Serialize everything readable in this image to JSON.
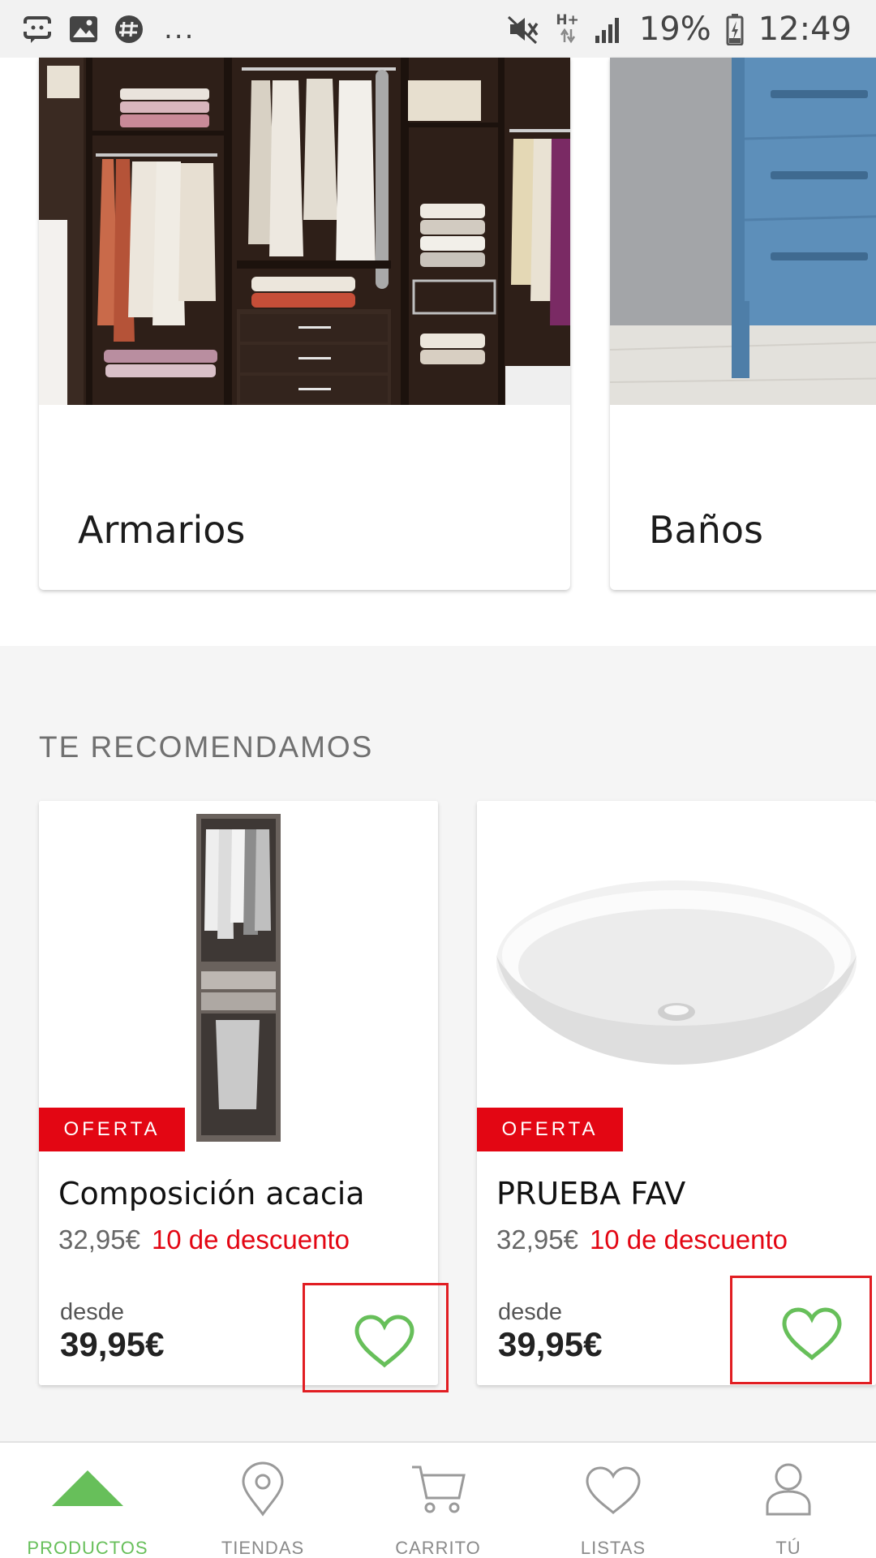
{
  "status_bar": {
    "battery": "19%",
    "time": "12:49",
    "network": "H+",
    "more": "..."
  },
  "categories": [
    {
      "label": "Armarios",
      "image": "wardrobe-photo"
    },
    {
      "label": "Baños",
      "image": "bathroom-cabinet-photo"
    }
  ],
  "recommend": {
    "title": "TE RECOMENDAMOS",
    "products": [
      {
        "badge": "OFERTA",
        "name": "Composición acacia",
        "old_price": "32,95€",
        "discount": "10 de descuento",
        "from_label": "desde",
        "price": "39,95€",
        "image": "wardrobe-module-photo"
      },
      {
        "badge": "OFERTA",
        "name": "PRUEBA FAV",
        "old_price": "32,95€",
        "discount": "10 de descuento",
        "from_label": "desde",
        "price": "39,95€",
        "image": "washbasin-photo"
      }
    ]
  },
  "bottom_nav": [
    {
      "label": "PRODUCTOS",
      "icon": "triangle-icon",
      "active": true
    },
    {
      "label": "TIENDAS",
      "icon": "location-pin-icon",
      "active": false
    },
    {
      "label": "CARRITO",
      "icon": "cart-icon",
      "active": false
    },
    {
      "label": "LISTAS",
      "icon": "heart-icon",
      "active": false
    },
    {
      "label": "TÚ",
      "icon": "user-icon",
      "active": false
    }
  ],
  "colors": {
    "accent_green": "#67bf5a",
    "offer_red": "#e30613",
    "highlight_red": "#e11d22"
  }
}
